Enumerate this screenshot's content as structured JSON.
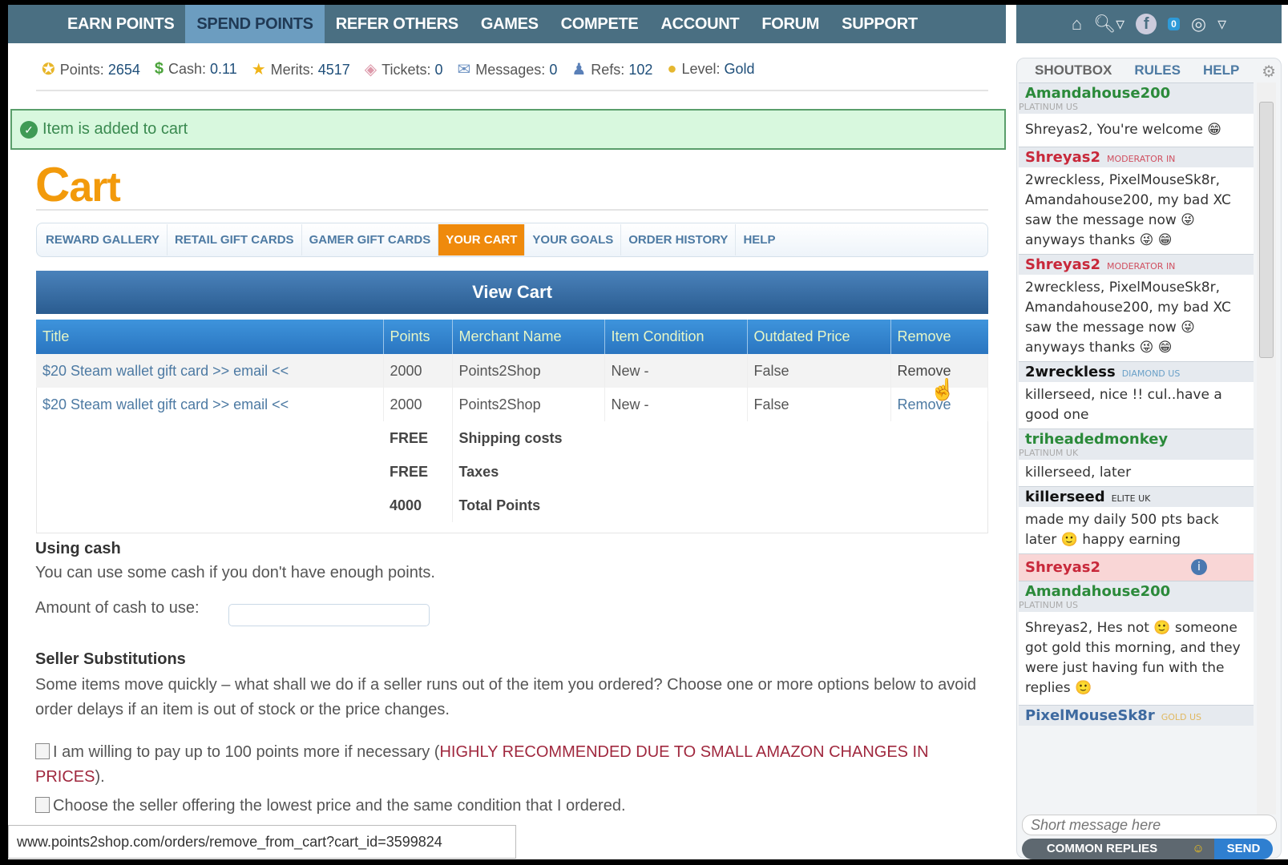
{
  "nav": {
    "items": [
      "EARN POINTS",
      "SPEND POINTS",
      "REFER OTHERS",
      "GAMES",
      "COMPETE",
      "ACCOUNT",
      "FORUM",
      "SUPPORT"
    ],
    "active": 1,
    "notif_count": "0"
  },
  "stats": [
    {
      "label": "Points:",
      "value": "2654",
      "icon": "medal-icon"
    },
    {
      "label": "Cash:",
      "value": "0.11",
      "icon": "dollar-icon"
    },
    {
      "label": "Merits:",
      "value": "4517",
      "icon": "star-icon"
    },
    {
      "label": "Tickets:",
      "value": "0",
      "icon": "tag-icon"
    },
    {
      "label": "Messages:",
      "value": "0",
      "icon": "envelope-icon"
    },
    {
      "label": "Refs:",
      "value": "102",
      "icon": "user-icon"
    },
    {
      "label": "Level:",
      "value": "Gold",
      "icon": "gold-medal-icon"
    }
  ],
  "alert": "Item is added to cart",
  "page_title": {
    "first": "C",
    "rest": "art"
  },
  "subnav": [
    "REWARD GALLERY",
    "RETAIL GIFT CARDS",
    "GAMER GIFT CARDS",
    "YOUR CART",
    "YOUR GOALS",
    "ORDER HISTORY",
    "HELP"
  ],
  "cart": {
    "heading": "View Cart",
    "columns": [
      "Title",
      "Points",
      "Merchant Name",
      "Item Condition",
      "Outdated Price",
      "Remove"
    ],
    "rows": [
      [
        "$20 Steam wallet gift card >> email <<",
        "2000",
        "Points2Shop",
        "New -",
        "False",
        "Remove"
      ],
      [
        "$20 Steam wallet gift card >> email <<",
        "2000",
        "Points2Shop",
        "New -",
        "False",
        "Remove"
      ]
    ],
    "summary": [
      [
        "FREE",
        "Shipping costs"
      ],
      [
        "FREE",
        "Taxes"
      ],
      [
        "4000",
        "Total Points"
      ]
    ]
  },
  "cash": {
    "heading": "Using cash",
    "text": "You can use some cash if you don't have enough points.",
    "label": "Amount of cash to use:",
    "value": ""
  },
  "subs": {
    "heading": "Seller Substitutions",
    "text": "Some items move quickly – what shall we do if a seller runs out of the item you ordered? Choose one or more options below to avoid order delays if an item is out of stock or the price changes.",
    "opt1": "I am willing to pay up to 100 points more if necessary (",
    "opt1_red": "HIGHLY RECOMMENDED DUE TO SMALL AMAZON CHANGES IN PRICES",
    "opt1_end": ").",
    "opt2": "Choose the seller offering the lowest price and the same condition that I ordered."
  },
  "status_url": "www.points2shop.com/orders/remove_from_cart?cart_id=3599824",
  "shoutbox": {
    "tabs": [
      "SHOUTBOX",
      "RULES",
      "HELP"
    ],
    "messages": [
      {
        "user": "Amandahouse200",
        "rank": "PLATINUM US",
        "text": "Shreyas2, You're welcome 😁"
      },
      {
        "user": "Shreyas2",
        "rank": "MODERATOR IN",
        "text": "2wreckless, PixelMouseSk8r, Amandahouse200, my bad XC saw the message now 😜 anyways thanks 😜 😁"
      },
      {
        "user": "Shreyas2",
        "rank": "MODERATOR IN",
        "text": "2wreckless, PixelMouseSk8r, Amandahouse200, my bad XC saw the message now 😜 anyways thanks 😜 😁"
      },
      {
        "user": "2wreckless",
        "rank": "DIAMOND US",
        "text": "killerseed, nice !! cul..have a good one"
      },
      {
        "user": "triheadedmonkey",
        "rank": "PLATINUM UK",
        "text": "killerseed, later"
      },
      {
        "user": "killerseed",
        "rank": "ELITE UK",
        "text": "made my daily 500 pts back later 🙂 happy earning"
      },
      {
        "user": "Shreyas2"
      },
      {
        "user": "Amandahouse200",
        "rank": "PLATINUM US",
        "text": "Shreyas2, Hes not 🙂 someone got gold this morning, and they were just having fun with the replies 🙂"
      },
      {
        "user": "PixelMouseSk8r",
        "rank": "GOLD US"
      }
    ],
    "placeholder": "Short message here",
    "common_replies": "COMMON REPLIES",
    "send": "SEND"
  }
}
